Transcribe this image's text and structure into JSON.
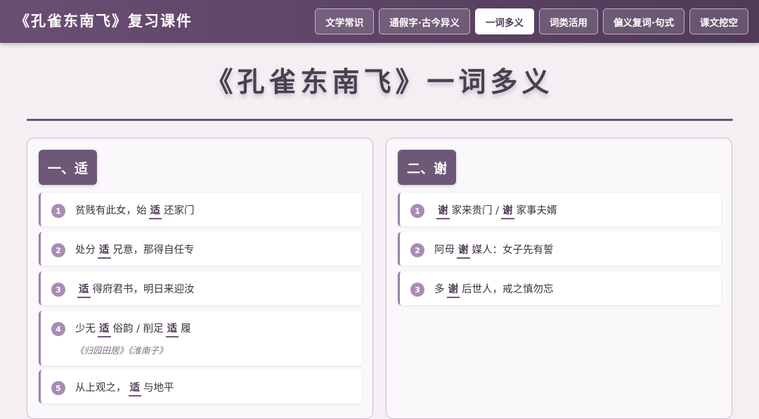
{
  "header": {
    "title": "《孔雀东南飞》复习课件",
    "tabs": [
      {
        "label": "文学常识",
        "active": false
      },
      {
        "label": "通假字·古今异义",
        "active": false
      },
      {
        "label": "一词多义",
        "active": true
      },
      {
        "label": "词类活用",
        "active": false
      },
      {
        "label": "偏义复词·句式",
        "active": false
      },
      {
        "label": "课文挖空",
        "active": false
      }
    ]
  },
  "page": {
    "title": "《孔雀东南飞》一词多义"
  },
  "sections": [
    {
      "heading": "一、适",
      "items": [
        {
          "num": "1",
          "parts": [
            "贫贱有此女，始",
            "适",
            "还家门"
          ]
        },
        {
          "num": "2",
          "parts": [
            "处分",
            "适",
            "兄意，那得自任专"
          ]
        },
        {
          "num": "3",
          "parts": [
            "",
            "适",
            "得府君书，明日来迎汝"
          ]
        },
        {
          "num": "4",
          "parts": [
            "少无",
            "适",
            "俗韵 / 削足",
            "适",
            "履"
          ],
          "source": "《归园田居》《淮南子》"
        },
        {
          "num": "5",
          "parts": [
            "从上观之，",
            "适",
            "与地平"
          ]
        }
      ]
    },
    {
      "heading": "二、谢",
      "items": [
        {
          "num": "1",
          "parts": [
            "",
            "谢",
            "家来贵门 /",
            "谢",
            "家事夫婿"
          ]
        },
        {
          "num": "2",
          "parts": [
            "阿母",
            "谢",
            "媒人：女子先有誓"
          ]
        },
        {
          "num": "3",
          "parts": [
            "多",
            "谢",
            "后世人，戒之慎勿忘"
          ]
        }
      ]
    }
  ],
  "colors": {
    "header_bg": "#5d4566",
    "accent": "#6e5777",
    "badge": "#a98cb6",
    "page_bg": "#f3eff3"
  }
}
